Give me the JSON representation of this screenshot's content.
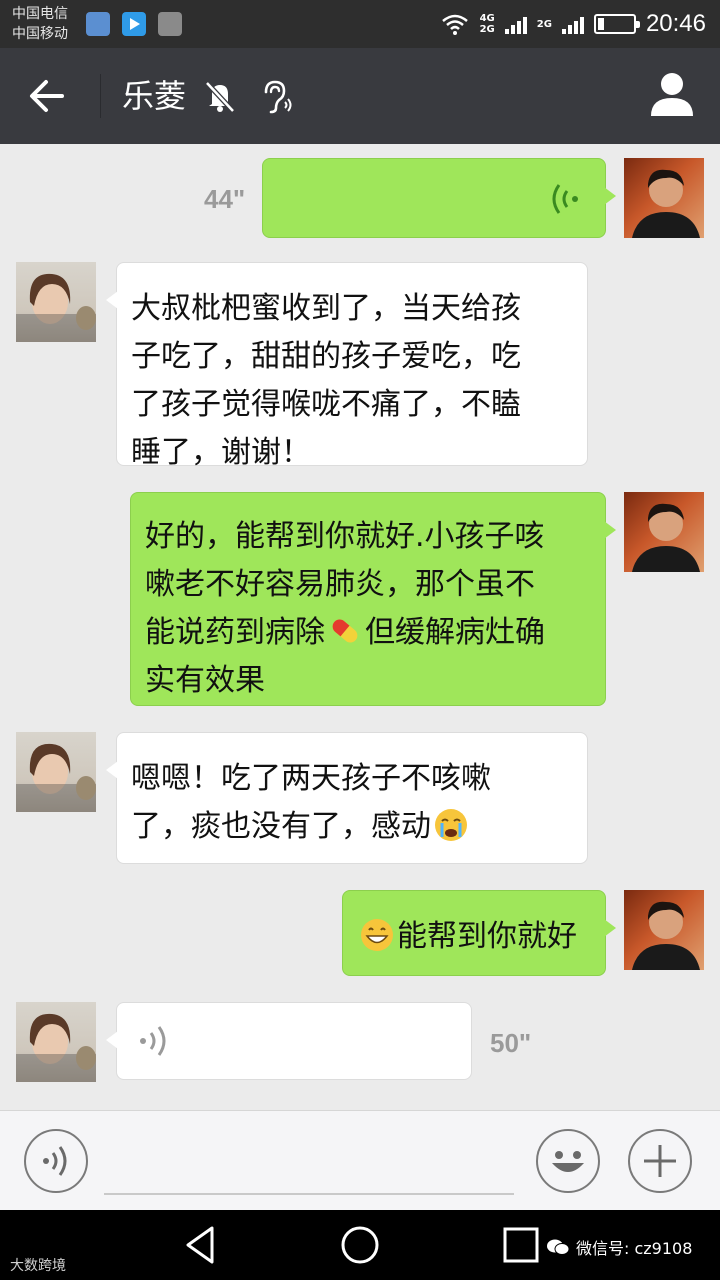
{
  "status_bar": {
    "carrier_1": "中国电信",
    "carrier_2": "中国移动",
    "net_top": "4G",
    "net_bottom": "2G",
    "net_2": "2G",
    "time": "20:46"
  },
  "header": {
    "title": "乐菱",
    "icons": [
      "back-arrow-icon",
      "bell-muted-icon",
      "ear-icon",
      "person-icon"
    ]
  },
  "messages": [
    {
      "sender": "me",
      "kind": "voice",
      "duration": "44\""
    },
    {
      "sender": "contact",
      "kind": "text",
      "lines": [
        "大叔枇杷蜜收到了，当天给孩",
        "子吃了，甜甜的孩子爱吃，吃",
        "了孩子觉得喉咙不痛了，不瞌",
        "睡了，谢谢！"
      ]
    },
    {
      "sender": "me",
      "kind": "text",
      "lines": [
        "好的，能帮到你就好.小孩子咳",
        "嗽老不好容易肺炎，那个虽不",
        "能说药到病除",
        "但缓解病灶确",
        "实有效果"
      ],
      "emoji": "pill"
    },
    {
      "sender": "contact",
      "kind": "text",
      "lines": [
        "嗯嗯！吃了两天孩子不咳嗽",
        "了，痰也没有了，感动"
      ],
      "emoji": "crying-face"
    },
    {
      "sender": "me",
      "kind": "text",
      "lines": [
        "能帮到你就好"
      ],
      "emoji": "grinning-face"
    },
    {
      "sender": "contact",
      "kind": "voice",
      "duration": "50\""
    }
  ],
  "input_bar": {
    "icons": [
      "voice-input-icon",
      "emoji-icon",
      "plus-icon"
    ]
  },
  "watermark": {
    "left": "大数跨境",
    "right": "微信号: cz9108"
  },
  "colors": {
    "header_bg": "#393a3f",
    "bubble_green": "#9fe65a",
    "bubble_white": "#ffffff",
    "chat_bg": "#ebebeb"
  }
}
